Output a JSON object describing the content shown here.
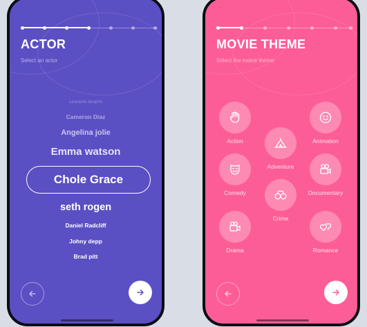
{
  "colors": {
    "actor_bg": "#5b4fc4",
    "theme_bg": "#fd5d96",
    "canvas_bg": "#d9dee6",
    "accent_white": "#ffffff"
  },
  "actor_screen": {
    "title": "ACTOR",
    "subtitle": "Select an actor",
    "progress": {
      "steps": 7,
      "completed": 4
    },
    "actors": [
      "Leonardo dicaprio",
      "Cameron Diaz",
      "Angelina jolie",
      "Emma watson",
      "Chole Grace",
      "seth rogen",
      "Daniel Radcliff",
      "Johny depp",
      "Brad pitt"
    ],
    "selected_actor": "Chole Grace",
    "back_icon": "arrow-left-icon",
    "next_icon": "arrow-right-icon"
  },
  "theme_screen": {
    "title": "MOVIE THEME",
    "subtitle": "Select the moive theme",
    "progress": {
      "steps": 7,
      "completed": 2
    },
    "themes": [
      {
        "label": "Action",
        "icon": "fist-icon"
      },
      {
        "label": "Animation",
        "icon": "smiley-icon"
      },
      {
        "label": "Adventure",
        "icon": "tent-icon"
      },
      {
        "label": "Comedy",
        "icon": "comedy-mask-icon"
      },
      {
        "label": "Documentary",
        "icon": "film-camera-icon"
      },
      {
        "label": "Crime",
        "icon": "handcuffs-icon"
      },
      {
        "label": "Drama",
        "icon": "movie-camera-icon"
      },
      {
        "label": "Romance",
        "icon": "hearts-icon"
      }
    ],
    "back_icon": "arrow-left-icon",
    "next_icon": "arrow-right-icon"
  }
}
